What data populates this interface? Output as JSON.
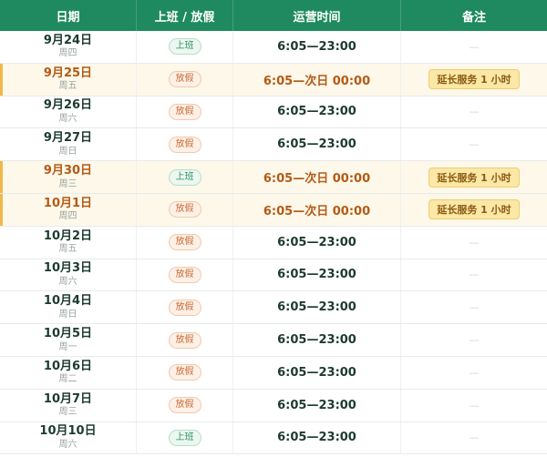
{
  "headers": {
    "date": "日期",
    "status": "上班 / 放假",
    "hours": "运营时间",
    "note": "备注"
  },
  "rows": [
    {
      "date": "9月24日",
      "weekday": "周四",
      "status": "上班",
      "status_type": "work",
      "hours": "6:05—23:00",
      "note": "—",
      "highlight": false
    },
    {
      "date": "9月25日",
      "weekday": "周五",
      "status": "放假",
      "status_type": "off",
      "hours": "6:05—次日 00:00",
      "note": "延长服务 1 小时",
      "highlight": true
    },
    {
      "date": "9月26日",
      "weekday": "周六",
      "status": "放假",
      "status_type": "off",
      "hours": "6:05—23:00",
      "note": "—",
      "highlight": false
    },
    {
      "date": "9月27日",
      "weekday": "周日",
      "status": "放假",
      "status_type": "off",
      "hours": "6:05—23:00",
      "note": "—",
      "highlight": false
    },
    {
      "date": "9月30日",
      "weekday": "周三",
      "status": "上班",
      "status_type": "work",
      "hours": "6:05—次日 00:00",
      "note": "延长服务 1 小时",
      "highlight": true
    },
    {
      "date": "10月1日",
      "weekday": "周四",
      "status": "放假",
      "status_type": "off",
      "hours": "6:05—次日 00:00",
      "note": "延长服务 1 小时",
      "highlight": true
    },
    {
      "date": "10月2日",
      "weekday": "周五",
      "status": "放假",
      "status_type": "off",
      "hours": "6:05—23:00",
      "note": "—",
      "highlight": false
    },
    {
      "date": "10月3日",
      "weekday": "周六",
      "status": "放假",
      "status_type": "off",
      "hours": "6:05—23:00",
      "note": "—",
      "highlight": false
    },
    {
      "date": "10月4日",
      "weekday": "周日",
      "status": "放假",
      "status_type": "off",
      "hours": "6:05—23:00",
      "note": "—",
      "highlight": false
    },
    {
      "date": "10月5日",
      "weekday": "周一",
      "status": "放假",
      "status_type": "off",
      "hours": "6:05—23:00",
      "note": "—",
      "highlight": false
    },
    {
      "date": "10月6日",
      "weekday": "周二",
      "status": "放假",
      "status_type": "off",
      "hours": "6:05—23:00",
      "note": "—",
      "highlight": false
    },
    {
      "date": "10月7日",
      "weekday": "周三",
      "status": "放假",
      "status_type": "off",
      "hours": "6:05—23:00",
      "note": "—",
      "highlight": false
    },
    {
      "date": "10月10日",
      "weekday": "周六",
      "status": "上班",
      "status_type": "work",
      "hours": "6:05—23:00",
      "note": "—",
      "highlight": false
    }
  ],
  "colors": {
    "header_bg": "#1f8a5f",
    "highlight_bg": "#fdf8ea",
    "highlight_accent": "#f0b84a",
    "work_badge": "#2f8f62",
    "off_badge": "#c86b35",
    "extended_text": "#b35a16"
  }
}
